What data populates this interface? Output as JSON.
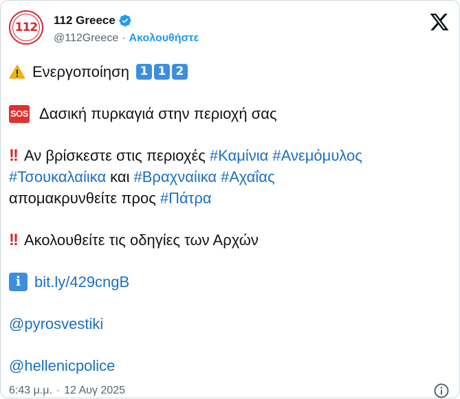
{
  "account": {
    "display_name": "112 Greece",
    "handle": "@112Greece",
    "separator": "·",
    "follow_label": "Ακολουθήστε",
    "avatar_text": "112"
  },
  "tweet": {
    "line1_text": "Ενεργοποίηση",
    "keycaps": [
      "1",
      "1",
      "2"
    ],
    "sos_label": "SOS",
    "line2_text": "Δασική πυρκαγιά στην περιοχή σας",
    "bang": "!!",
    "line3_prefix": "Αν βρίσκεστε στις περιοχές",
    "tag_kaminia": "#Καμίνια",
    "tag_anemomylos": "#Ανεμόμυλος",
    "tag_tsoukalaiika": "#Τσουκαλαίικα",
    "word_kai": "και",
    "tag_vrachnaiika": "#Βραχναίικα",
    "tag_achaias": "#Αχαΐας",
    "line5_prefix": "απομακρυνθείτε προς",
    "tag_patra": "#Πάτρα",
    "line6_text": "Ακολουθείτε τις οδηγίες των Αρχών",
    "info_glyph": "i",
    "link_text": "bit.ly/429cngB",
    "mention1": "@pyrosvestiki",
    "mention2": "@hellenicpolice"
  },
  "footer": {
    "time": "6:43 μ.μ.",
    "separator": "·",
    "date": "12 Αυγ 2025"
  },
  "colors": {
    "link": "#1b6fc2",
    "follow": "#1d9bf0",
    "brand_red": "#d8262f"
  },
  "icons": [
    "verified-badge-icon",
    "x-logo-icon",
    "warning-icon",
    "info-icon"
  ]
}
